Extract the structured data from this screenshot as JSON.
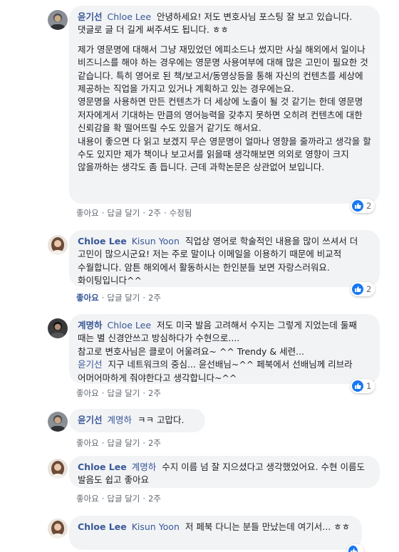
{
  "comments": [
    {
      "author": "윤기선",
      "mention": "Chloe Lee",
      "paragraphs": [
        "안녕하세요! 저도 변호사님 포스팅 잘 보고 있습니다. 댓글로 글 더 길게 써주셔도 됩니다. ㅎㅎ",
        "제가 영문명에 대해서 그냥 재밌었던 에피소드나 썼지만 사실 해외에서 일이나 비즈니스를 해야 하는 경우에는 영문명 사용여부에 대해 많은 고민이 필요한 것 같습니다. 특히 영어로 된 책/보고서/동영상등을 통해 자신의 컨텐츠를 세상에 제공하는 직업을 가지고 있거나 계획하고 있는 경우에는요.",
        "영문명을 사용하면 만든 컨텐츠가 더 세상에 노출이 될 것 같기는 한데 영문명 저자에게서 기대하는 만큼의 영어능력을 갖추지 못하면 오히려 컨텐츠에 대한 신뢰감을 확 떨어뜨릴 수도 있을거 같기도 해서요.",
        "내용이 좋으면 다 읽고 보겠지 무슨 영문명이 얼마나 영향을 줄까라고 생각을 할 수도 있지만 제가 책이나 보고서를 읽을때 생각해보면 의외로 영향이 크지 않을까하는 생각도 좀 듭니다. 근데 과학논문은 상관없어 보입니다."
      ],
      "actions": {
        "like": "좋아요",
        "reply": "답글 달기",
        "time": "2주",
        "edited": "수정됨"
      },
      "reaction_count": "2"
    },
    {
      "author": "Chloe Lee",
      "mention": "Kisun Yoon",
      "paragraphs": [
        "직업상 영어로 학술적인 내용을 많이 쓰셔서 더 고민이 많으시군요! 저는 주로 말이나 이메일을 이용하기 때문에 비교적 수월합니다. 암튼 해외에서 활동하시는 한인분들 보면 자랑스러워요. 화이팅입니다^^"
      ],
      "actions": {
        "like": "좋아요",
        "reply": "답글 달기",
        "time": "2주"
      },
      "reaction_count": "2"
    },
    {
      "author": "계명하",
      "mention": "Chloe Lee",
      "paragraphs": [
        "저도 미국 발음 고려해서 수지는 그렇게 지었는데 둘째 때는 별 신경안쓰고 방심하다가 수현으로....",
        "참고로 변호사님은 클로이 어울려요~ ^^ Trendy & 세련..."
      ],
      "mention2": "윤기선",
      "paragraph_tail": "지구 네트워크의 중심... 윤선배님~^^ 페북에서 선배님께 리브라 어머어마하게 줘야한다고 생각합니다~^^",
      "actions": {
        "like": "좋아요",
        "reply": "답글 달기",
        "time": "2주"
      },
      "reaction_count": "1"
    },
    {
      "author": "윤기선",
      "mention": "계명하",
      "paragraphs": [
        "ㅋㅋ 고맙다."
      ],
      "actions": {
        "like": "좋아요",
        "reply": "답글 달기",
        "time": "2주"
      }
    },
    {
      "author": "Chloe Lee",
      "mention": "계명하",
      "paragraphs": [
        "수지 이름 넘 잘 지으셨다고 생각했었어요. 수현 이름도 발음도 쉽고 좋아요"
      ],
      "actions": {
        "like": "좋아요",
        "reply": "답글 달기",
        "time": "2주"
      }
    },
    {
      "author": "Chloe Lee",
      "mention": "Kisun Yoon",
      "paragraphs": [
        "저 페북 다니는 분들 만났는데 여기서... ㅎㅎ"
      ]
    }
  ],
  "icons": {
    "like": "thumbs-up-icon"
  },
  "colors": {
    "link": "#385898",
    "bubble": "#f2f3f5",
    "like_badge": "#1877f2",
    "meta": "#606770"
  }
}
